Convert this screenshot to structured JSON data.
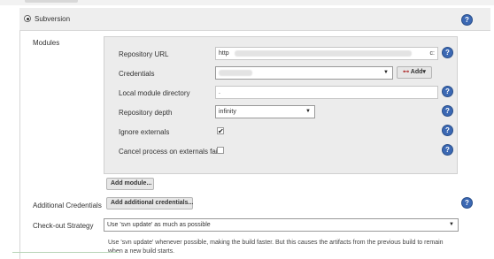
{
  "scm": {
    "label": "Subversion",
    "help": "?"
  },
  "modules": {
    "section_label": "Modules",
    "repository_url": {
      "label": "Repository URL",
      "value": "http",
      "suffix": "c:"
    },
    "credentials": {
      "label": "Credentials",
      "add_button": "Add"
    },
    "local_dir": {
      "label": "Local module directory",
      "value": "."
    },
    "depth": {
      "label": "Repository depth",
      "value": "infinity"
    },
    "ignore_externals": {
      "label": "Ignore externals",
      "checked": true,
      "mark": "✔"
    },
    "cancel_externals": {
      "label": "Cancel process on externals fail",
      "checked": false,
      "mark": ""
    },
    "add_module_button": "Add module..."
  },
  "additional_credentials": {
    "label": "Additional Credentials",
    "button": "Add additional credentials..."
  },
  "checkout": {
    "label": "Check-out Strategy",
    "value": "Use 'svn update' as much as possible",
    "description_line1": "Use 'svn update' whenever possible, making the build faster. But this causes the artifacts from the previous build to remain",
    "description_line2": "when a new build starts."
  },
  "icons": {
    "help": "help-icon",
    "caret": "chevron-down-icon",
    "key": "key-icon"
  }
}
